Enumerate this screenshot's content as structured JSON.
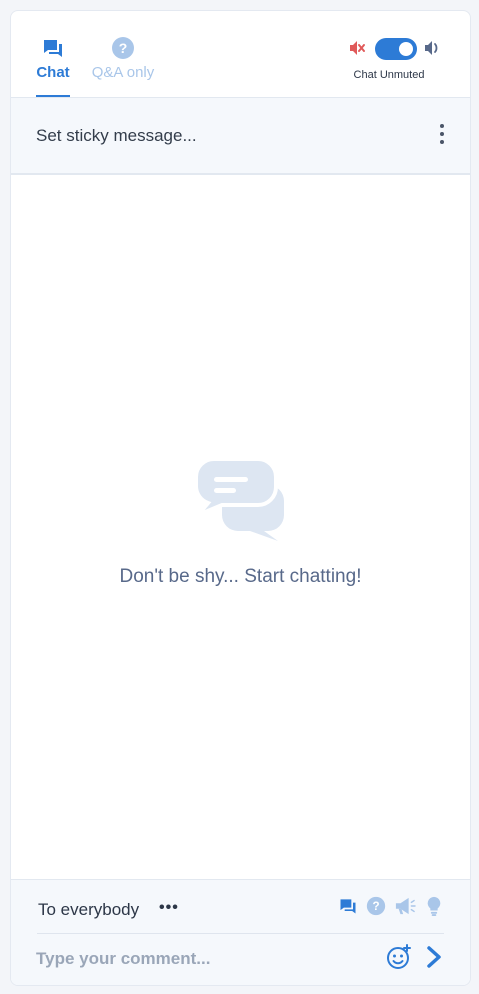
{
  "colors": {
    "accent": "#2d7bd6",
    "accent_light": "#a9c6e9",
    "muted_red": "#e05a5a"
  },
  "tabs": [
    {
      "label": "Chat",
      "icon": "chat-bubbles-icon",
      "active": true
    },
    {
      "label": "Q&A only",
      "icon": "question-circle-icon",
      "active": false
    }
  ],
  "mute": {
    "status": "Chat Unmuted",
    "toggle_on": true
  },
  "sticky": {
    "placeholder": "Set sticky message..."
  },
  "empty_state": {
    "icon": "chat-bubbles-icon",
    "message": "Don't be shy... Start chatting!"
  },
  "composer": {
    "recipient": "To everybody",
    "more": "•••",
    "placeholder": "Type your comment...",
    "message_types": [
      "chat-icon",
      "question-icon",
      "announcement-icon",
      "idea-icon"
    ]
  }
}
